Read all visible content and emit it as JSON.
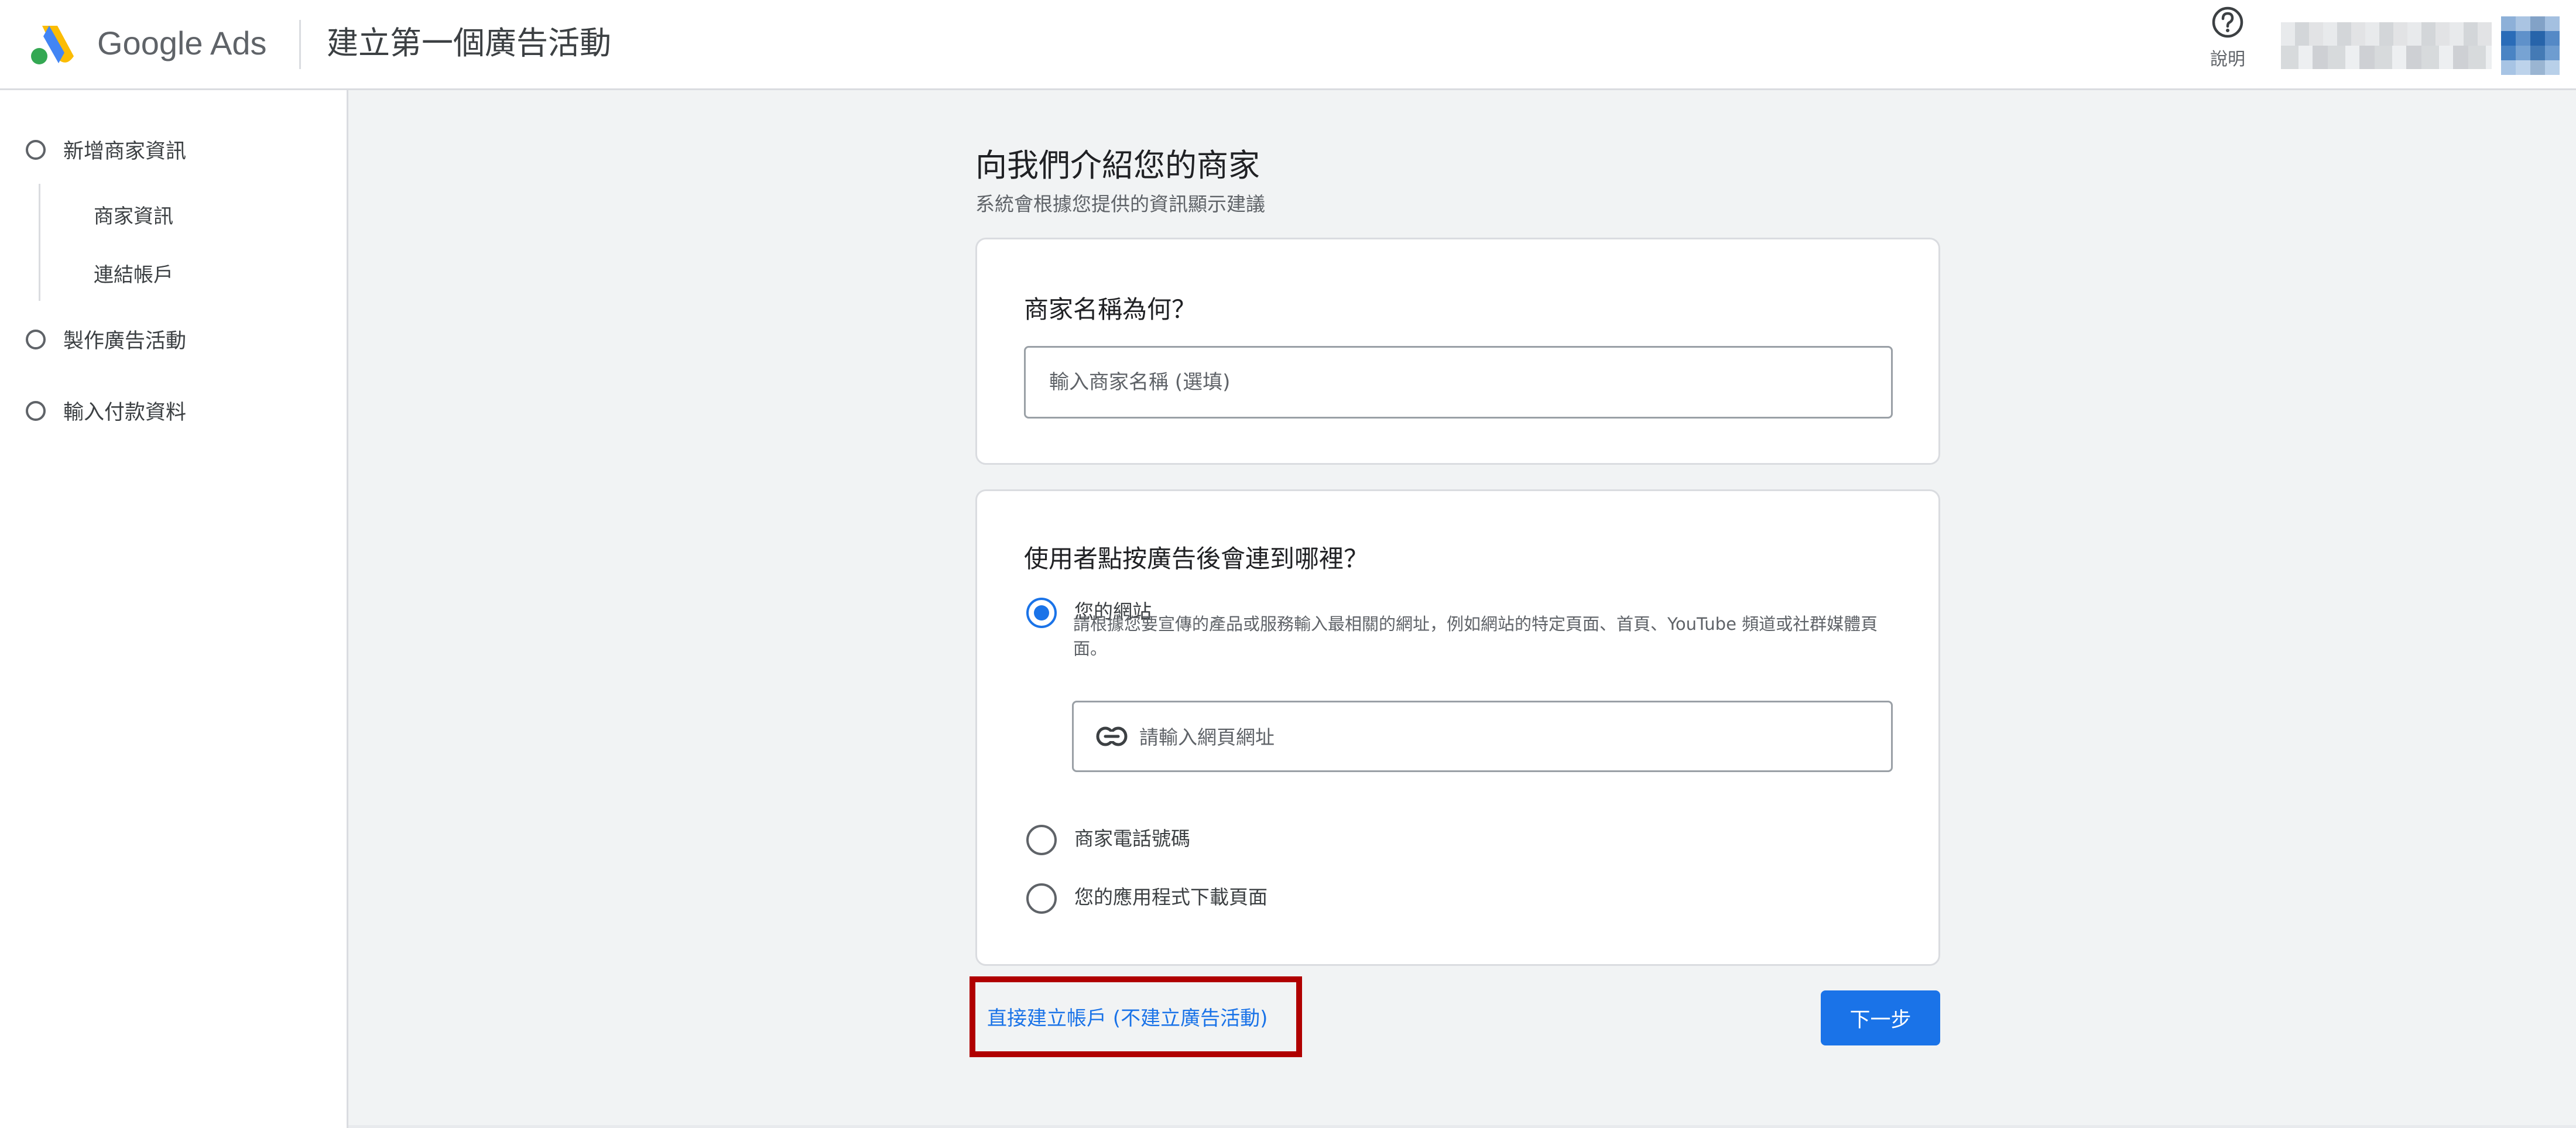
{
  "header": {
    "brand": "Google Ads",
    "title": "建立第一個廣告活動",
    "help_label": "說明"
  },
  "sidebar": {
    "steps": [
      {
        "label": "新增商家資訊",
        "sub_items": [
          "商家資訊",
          "連結帳戶"
        ]
      },
      {
        "label": "製作廣告活動"
      },
      {
        "label": "輸入付款資料"
      }
    ]
  },
  "main": {
    "title": "向我們介紹您的商家",
    "subtitle": "系統會根據您提供的資訊顯示建議",
    "business_card": {
      "question": "商家名稱為何？",
      "input_placeholder": "輸入商家名稱 (選填)",
      "input_value": ""
    },
    "destination_card": {
      "question": "使用者點按廣告後會連到哪裡？",
      "options": [
        {
          "label": "您的網站",
          "description": "請根據您要宣傳的產品或服務輸入最相關的網址，例如網站的特定頁面、首頁、YouTube 頻道或社群媒體頁面。",
          "selected": true
        },
        {
          "label": "商家電話號碼",
          "selected": false
        },
        {
          "label": "您的應用程式下載頁面",
          "selected": false
        }
      ],
      "url_placeholder": "請輸入網頁網址",
      "url_value": ""
    },
    "skip_link": "直接建立帳戶 (不建立廣告活動)",
    "next_button": "下一步"
  },
  "colors": {
    "accent": "#1a73e8",
    "highlight_border": "#b00000",
    "background": "#f1f3f4"
  }
}
